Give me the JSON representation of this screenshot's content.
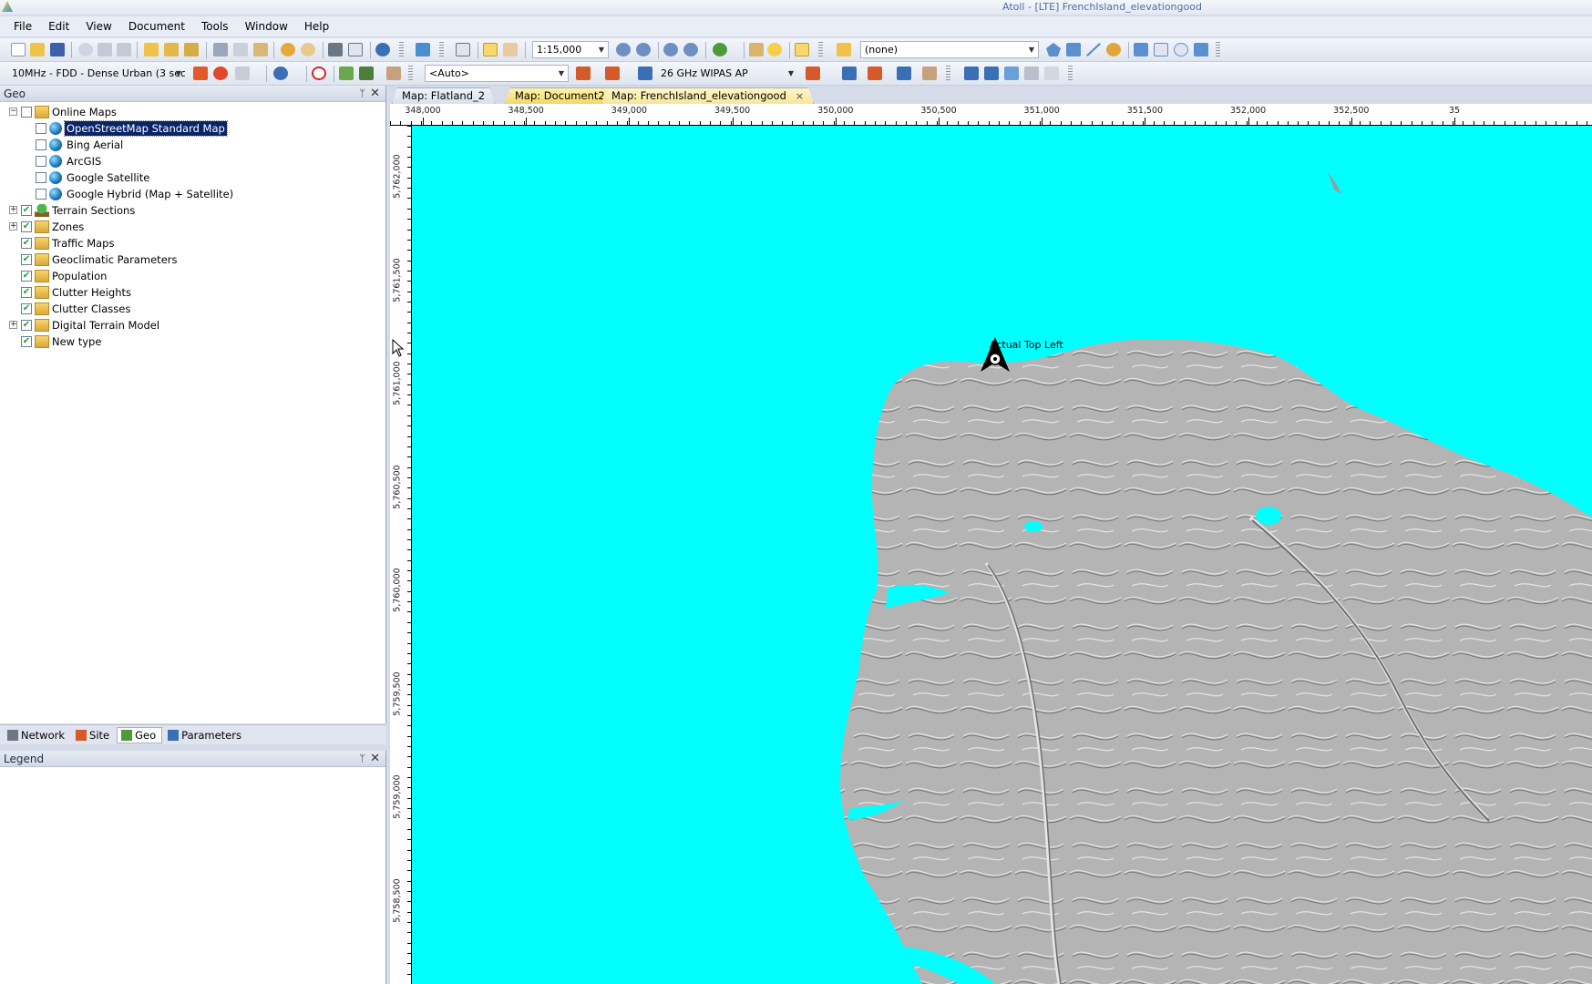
{
  "window": {
    "title": "Atoll - [LTE] FrenchIsland_elevationgood"
  },
  "menu": [
    "File",
    "Edit",
    "View",
    "Document",
    "Tools",
    "Window",
    "Help"
  ],
  "toolbar": {
    "scale": "1:15,000",
    "layer_select": "(none)",
    "bearer_select": "10MHz - FDD - Dense Urban (3 sec",
    "auto_select": "<Auto>",
    "equipment_select": "26 GHz WIPAS AP"
  },
  "geo_panel": {
    "title": "Geo",
    "tree": [
      {
        "label": "Online Maps",
        "level": 0,
        "expander": "−",
        "checked": false,
        "icon": "folder-globe-icon"
      },
      {
        "label": "OpenStreetMap Standard Map",
        "level": 1,
        "checked": false,
        "icon": "globe-icon",
        "selected": true
      },
      {
        "label": "Bing Aerial",
        "level": 1,
        "checked": false,
        "icon": "globe-icon"
      },
      {
        "label": "ArcGIS",
        "level": 1,
        "checked": false,
        "icon": "globe-icon"
      },
      {
        "label": "Google Satellite",
        "level": 1,
        "checked": false,
        "icon": "globe-icon"
      },
      {
        "label": "Google Hybrid (Map + Satellite)",
        "level": 1,
        "checked": false,
        "icon": "globe-icon"
      },
      {
        "label": "Terrain Sections",
        "level": 0,
        "expander": "+",
        "checked": true,
        "icon": "tree-icon"
      },
      {
        "label": "Zones",
        "level": 0,
        "expander": "+",
        "checked": true,
        "icon": "zones-icon"
      },
      {
        "label": "Traffic Maps",
        "level": 0,
        "checked": true,
        "icon": "folder-icon"
      },
      {
        "label": "Geoclimatic Parameters",
        "level": 0,
        "checked": true,
        "icon": "folder-icon"
      },
      {
        "label": "Population",
        "level": 0,
        "checked": true,
        "icon": "folder-icon"
      },
      {
        "label": "Clutter Heights",
        "level": 0,
        "checked": true,
        "icon": "folder-icon"
      },
      {
        "label": "Clutter Classes",
        "level": 0,
        "checked": true,
        "icon": "folder-icon"
      },
      {
        "label": "Digital Terrain Model",
        "level": 0,
        "expander": "+",
        "checked": true,
        "icon": "folder-icon"
      },
      {
        "label": "New type",
        "level": 0,
        "checked": true,
        "icon": "folder-icon"
      }
    ]
  },
  "panel_tabs": [
    {
      "label": "Network",
      "icon": "network-icon",
      "active": false
    },
    {
      "label": "Site",
      "icon": "site-icon",
      "active": false
    },
    {
      "label": "Geo",
      "icon": "geo-icon",
      "active": true
    },
    {
      "label": "Parameters",
      "icon": "parameters-icon",
      "active": false
    }
  ],
  "legend_panel": {
    "title": "Legend"
  },
  "map_tabs": [
    {
      "label": "Map: Flatland_2"
    },
    {
      "label": "Map: Document2"
    },
    {
      "label": "Map: FrenchIsland_elevationgood",
      "closable": true,
      "close_glyph": "×"
    }
  ],
  "map": {
    "x_ticks": [
      "348,000",
      "348,500",
      "349,000",
      "349,500",
      "350,000",
      "350,500",
      "351,000",
      "351,500",
      "352,000",
      "352,500",
      "35"
    ],
    "y_ticks": [
      "5,762,000",
      "5,761,500",
      "5,761,000",
      "5,760,500",
      "5,760,000",
      "5,759,500",
      "5,759,000",
      "5,758,500"
    ],
    "site_label": "Actual Top Left",
    "colors": {
      "water": "#00ffff",
      "land": "#b4b4b4",
      "relief_light": "#e6e6e6",
      "relief_dark": "#6e6e6e"
    }
  }
}
